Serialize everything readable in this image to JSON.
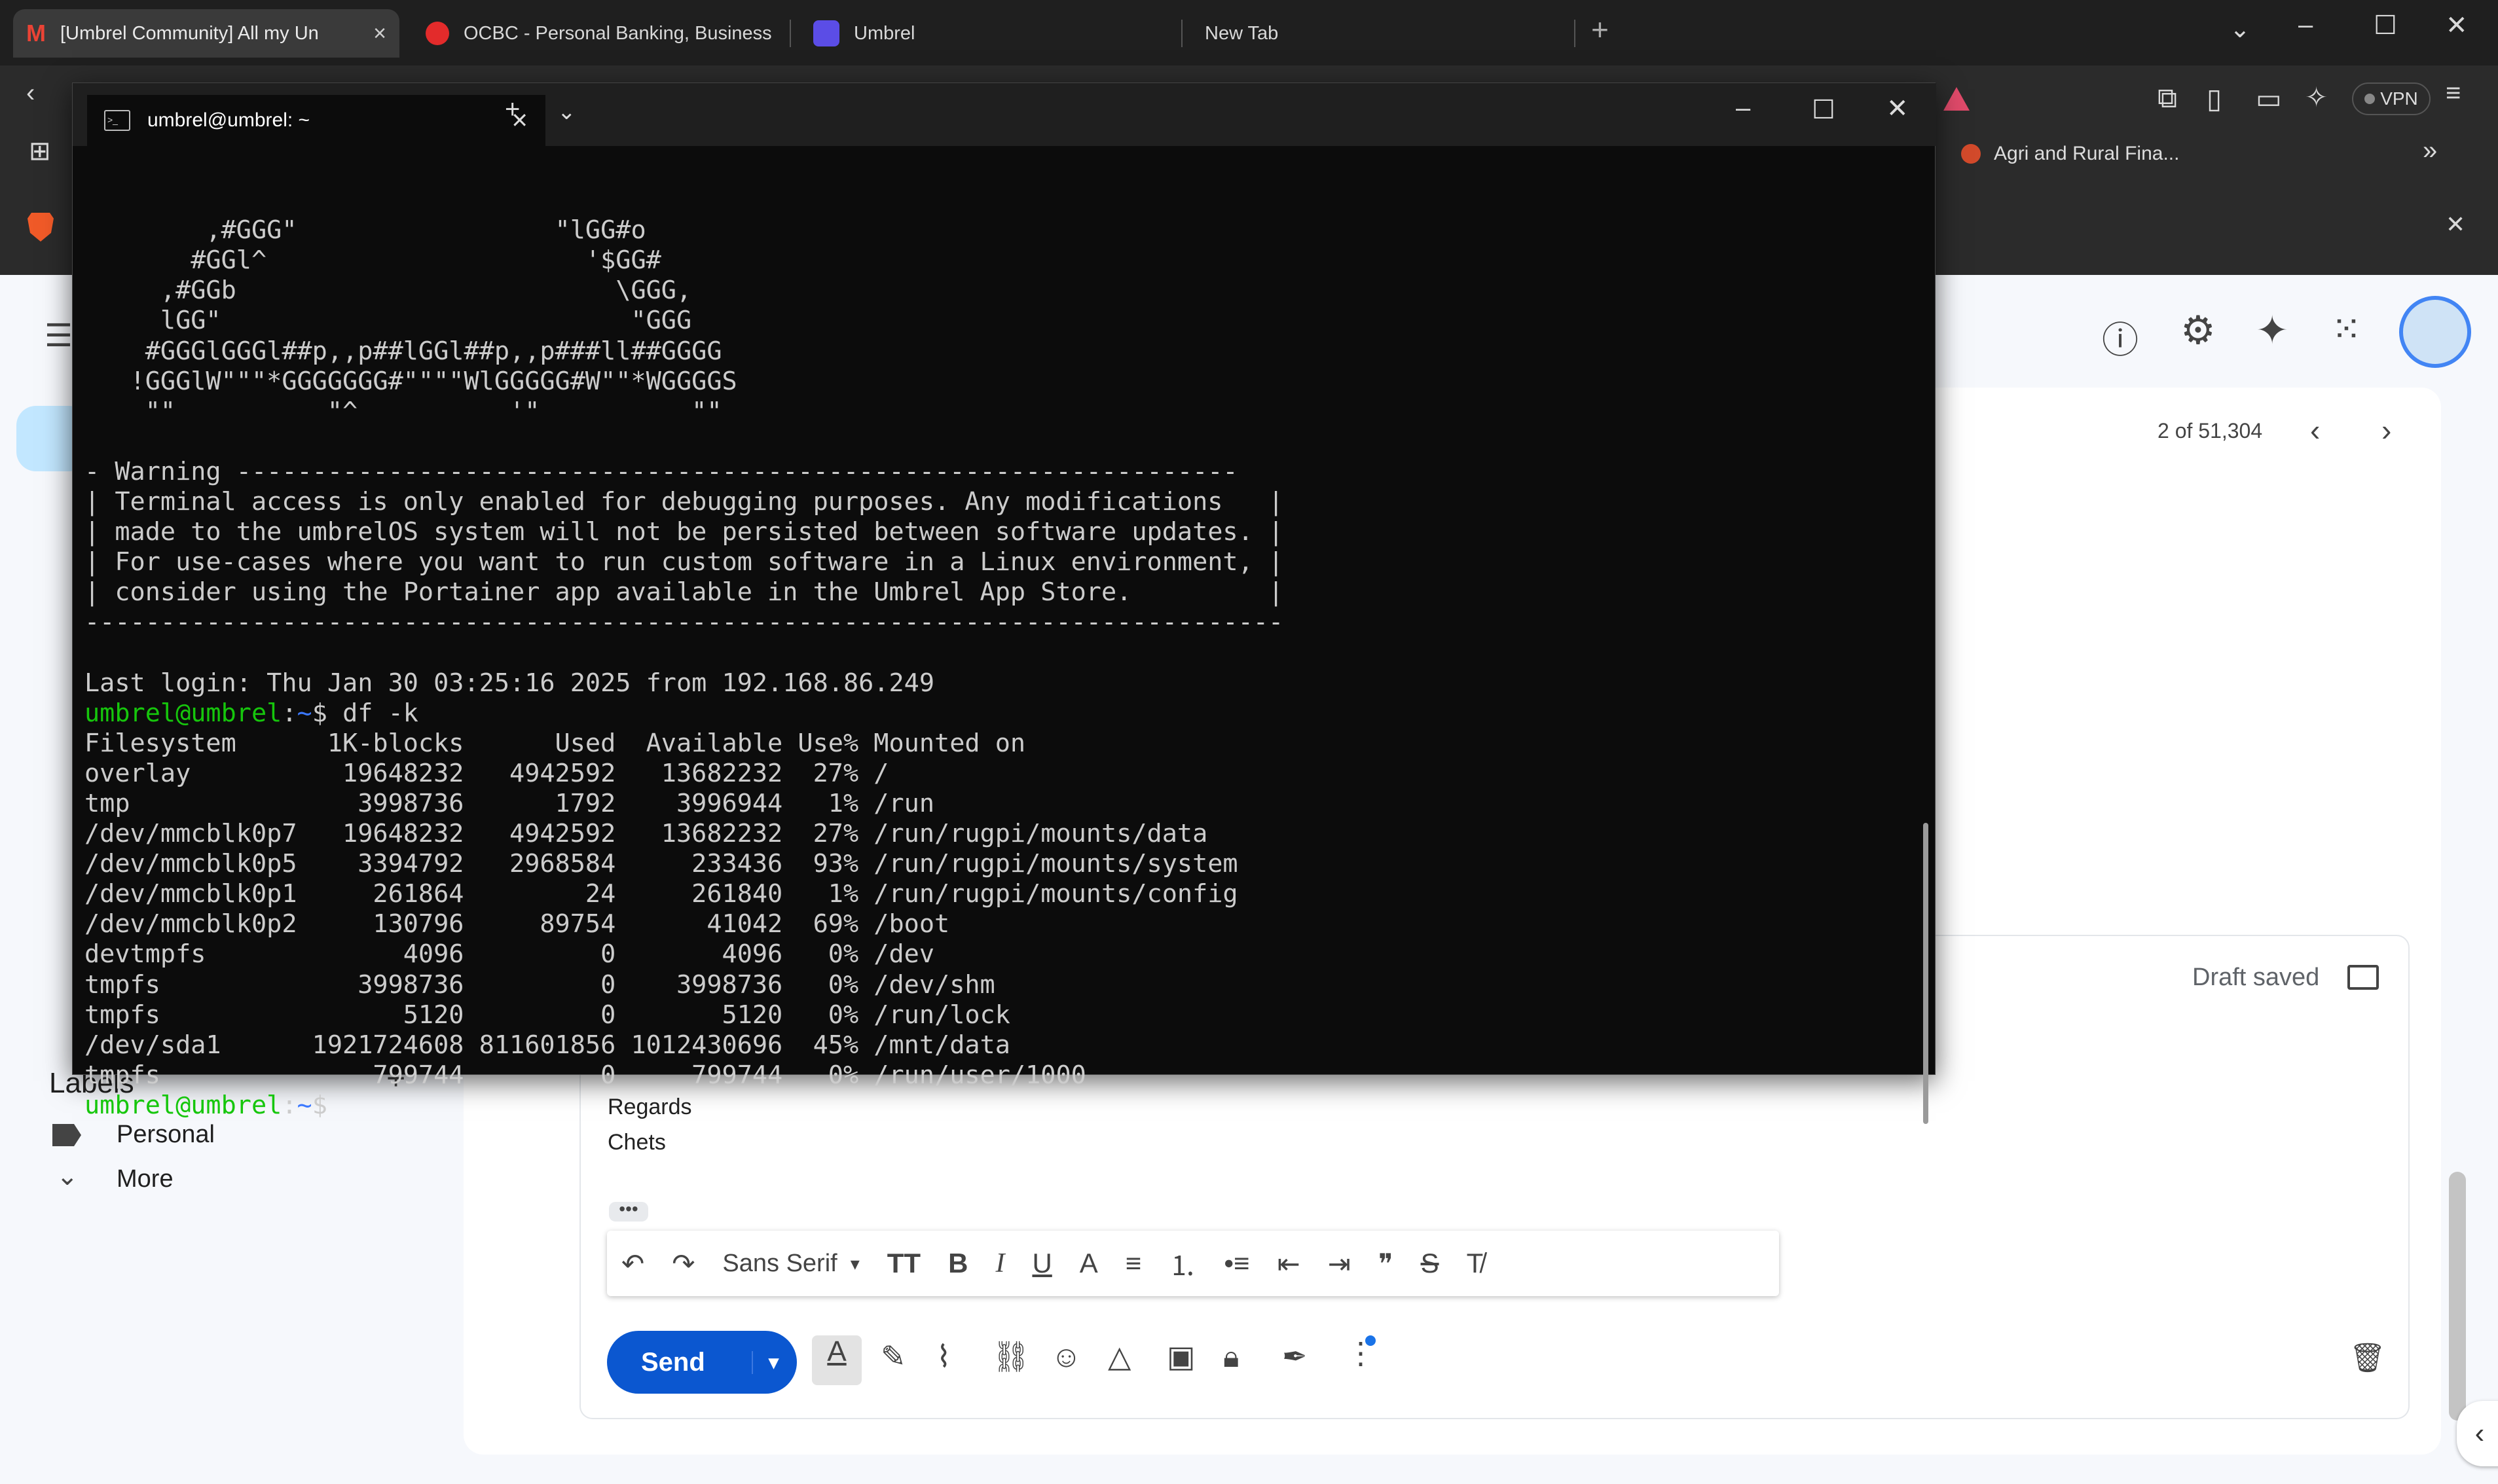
{
  "browser": {
    "tabs": [
      {
        "label": "[Umbrel Community] All my Un",
        "icon": "gmail-icon",
        "active": true
      },
      {
        "label": "OCBC - Personal Banking, Business",
        "icon": "ocbc-icon",
        "active": false
      },
      {
        "label": "Umbrel",
        "icon": "umbrel-icon",
        "active": false
      },
      {
        "label": "New Tab",
        "icon": "",
        "active": false
      }
    ],
    "new_tab_glyph": "+",
    "vpn_label": "VPN",
    "bookmark": "Agri and Rural Fina...",
    "more_bookmarks": "»"
  },
  "terminal": {
    "title": "umbrel@umbrel: ~",
    "ascii_art": [
      "        ,#GGG\"                 \"lGG#o",
      "       #GGl^                     '$GG#",
      "     ,#GGb                         \\GGG,",
      "     lGG\"                           \"GGG",
      "    #GGGlGGGl##p,,p##lGGl##p,,p###ll##GGGG",
      "   !GGGlW\"\"\"*GGGGGGG#\"\"\"\"WlGGGGG#W\"\"*WGGGGS",
      "    \"\"          \"^          '\"          \"\""
    ],
    "warning": [
      "- Warning ------------------------------------------------------------------",
      "| Terminal access is only enabled for debugging purposes. Any modifications   |",
      "| made to the umbrelOS system will not be persisted between software updates. |",
      "| For use-cases where you want to run custom software in a Linux environment, |",
      "| consider using the Portainer app available in the Umbrel App Store.         |",
      "-------------------------------------------------------------------------------"
    ],
    "last_login": "Last login: Thu Jan 30 03:25:16 2025 from 192.168.86.249",
    "prompt_user": "umbrel@umbrel",
    "prompt_path": "~",
    "prompt_symbol": "$",
    "command": " df -k",
    "df_header": "Filesystem      1K-blocks      Used  Available Use% Mounted on",
    "df_rows": [
      "overlay          19648232   4942592   13682232  27% /",
      "tmp               3998736      1792    3996944   1% /run",
      "/dev/mmcblk0p7   19648232   4942592   13682232  27% /run/rugpi/mounts/data",
      "/dev/mmcblk0p5    3394792   2968584     233436  93% /run/rugpi/mounts/system",
      "/dev/mmcblk0p1     261864        24     261840   1% /run/rugpi/mounts/config",
      "/dev/mmcblk0p2     130796     89754      41042  69% /boot",
      "devtmpfs             4096         0       4096   0% /dev",
      "tmpfs             3998736         0    3998736   0% /dev/shm",
      "tmpfs                5120         0       5120   0% /run/lock",
      "/dev/sda1      1921724608 811601856 1012430696  45% /mnt/data",
      "tmpfs              799744         0     799744   0% /run/user/1000"
    ]
  },
  "gmail": {
    "pagination": "2 of 51,304",
    "draft_status": "Draft saved",
    "labels_heading": "Labels",
    "labels": [
      {
        "name": "Personal"
      }
    ],
    "more_label": "More",
    "signature_line1": "Regards",
    "signature_line2": "Chets",
    "font_select": "Sans Serif",
    "send_label": "Send"
  }
}
